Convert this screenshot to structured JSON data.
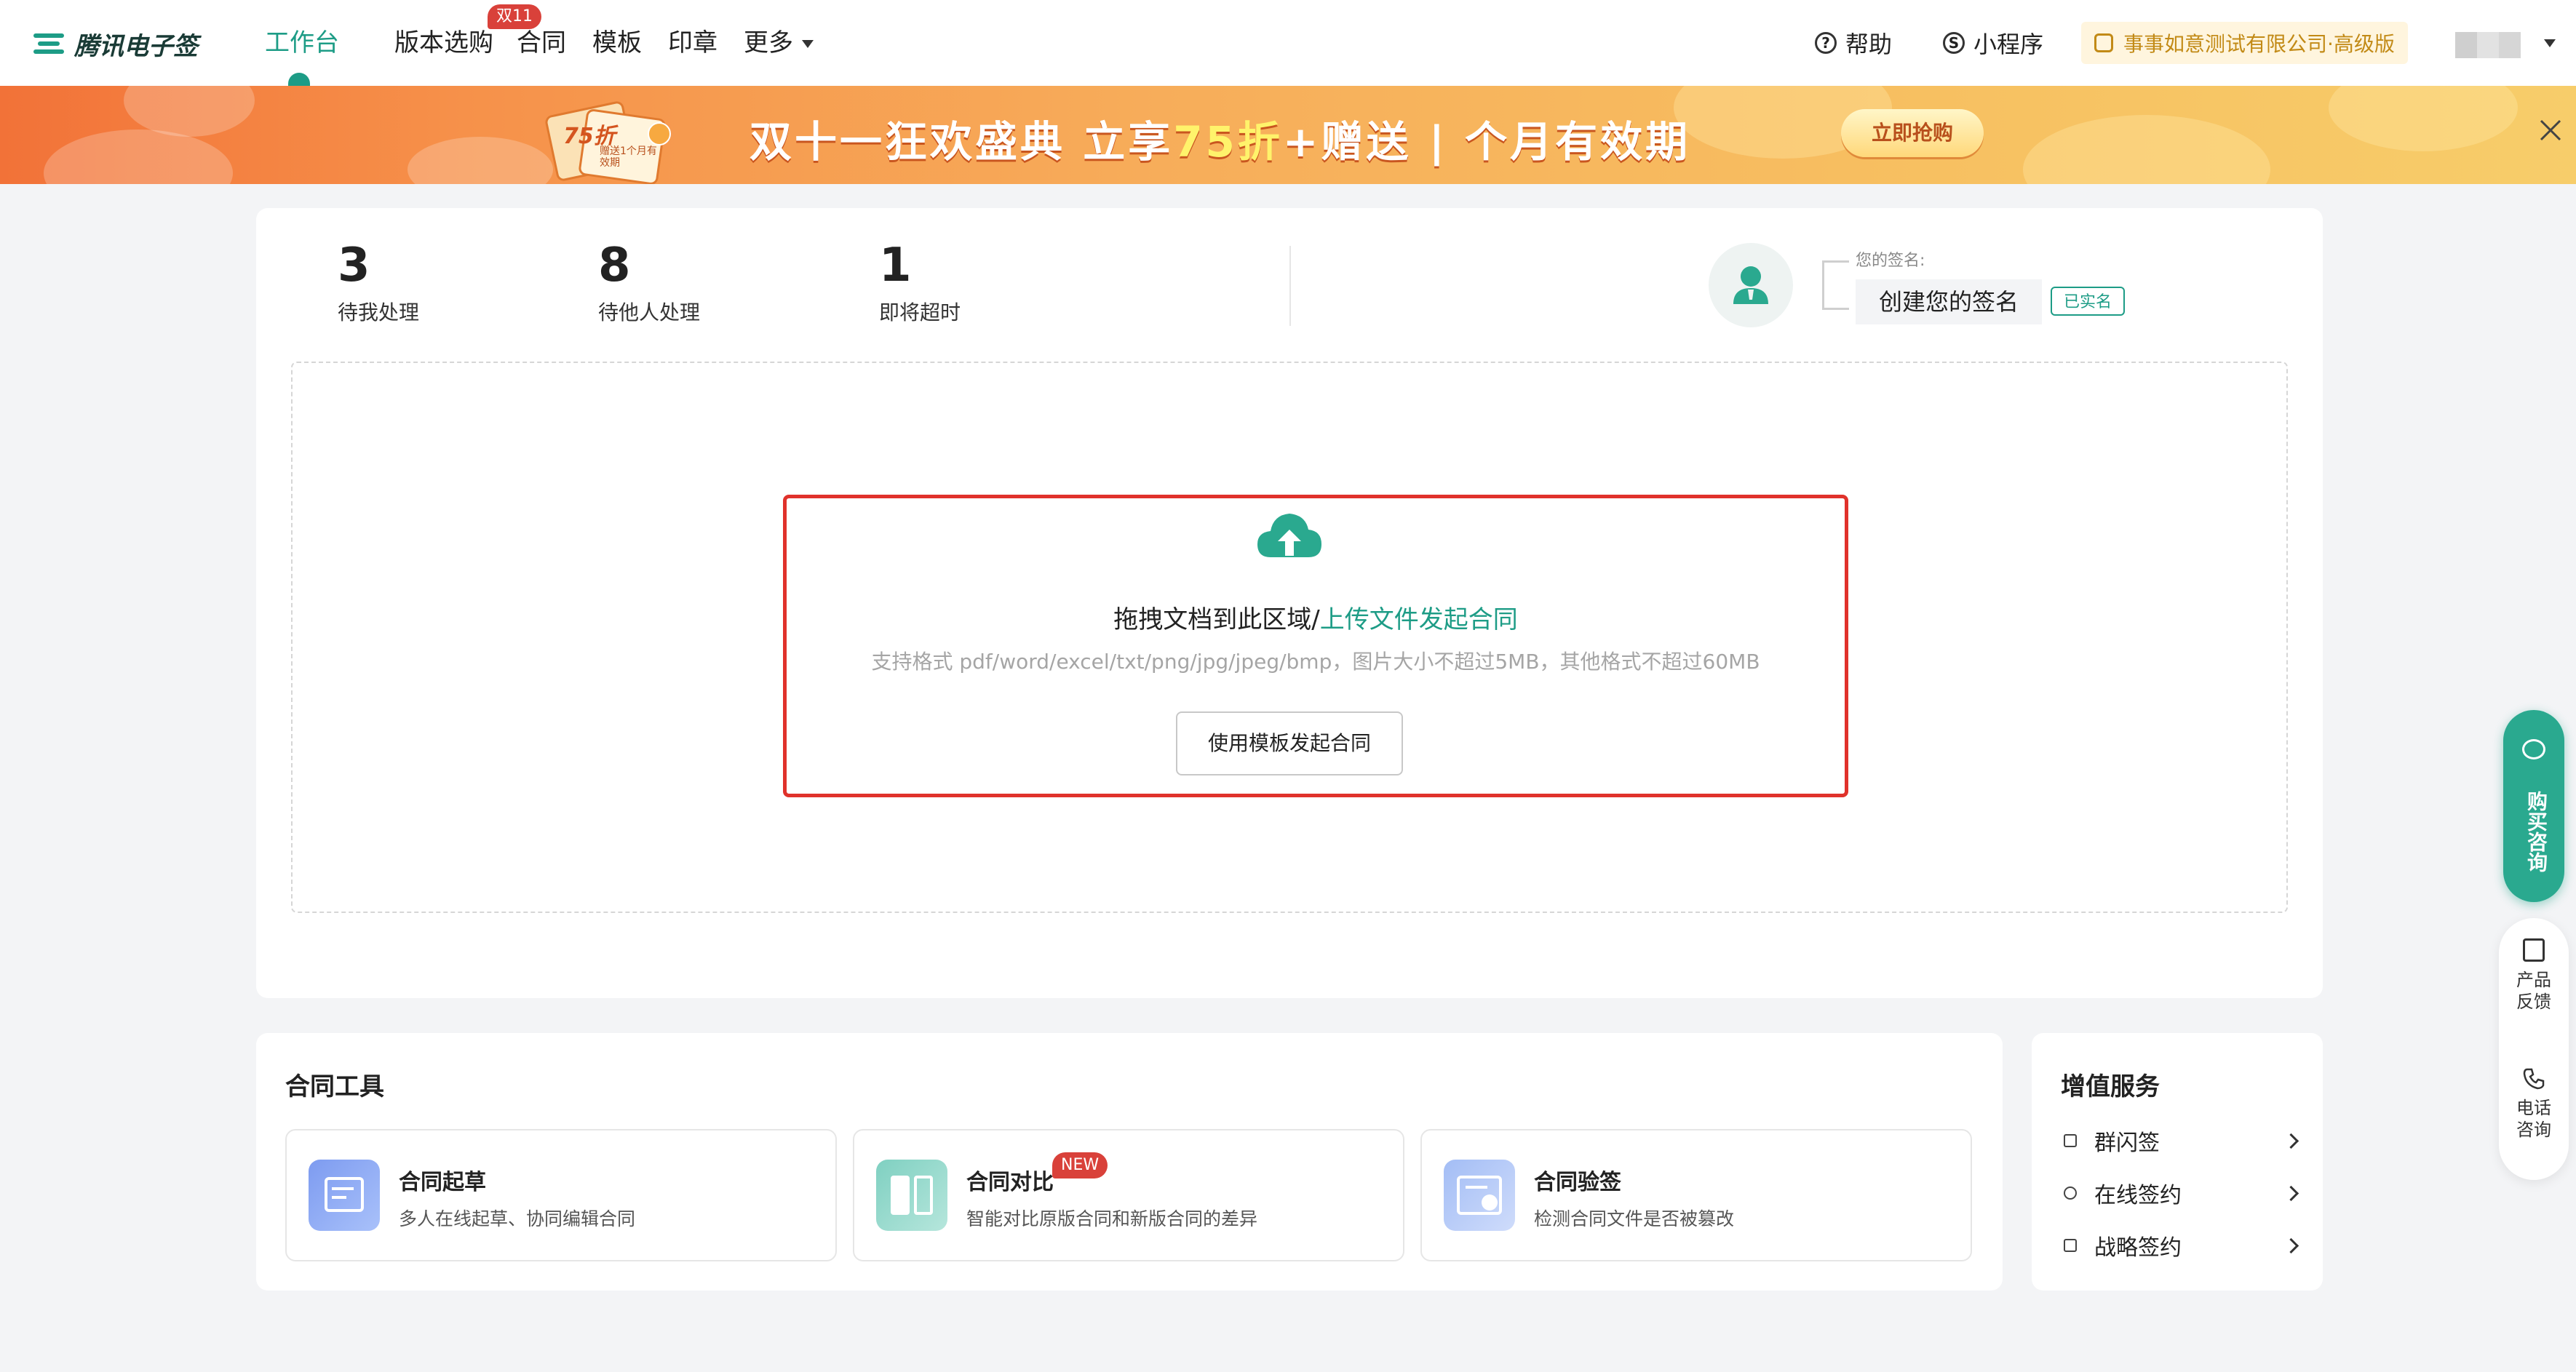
{
  "brand": {
    "logo_text": "腾讯电子签",
    "accent": "#1d9c86"
  },
  "nav": {
    "items": [
      {
        "label": "工作台",
        "active": true
      },
      {
        "label": "版本选购",
        "badge": "双11"
      },
      {
        "label": "合同"
      },
      {
        "label": "模板"
      },
      {
        "label": "印章"
      },
      {
        "label": "更多"
      }
    ],
    "help": "帮助",
    "miniprogram": "小程序",
    "company": "事事如意测试有限公司·高级版"
  },
  "banner": {
    "title_part1": "双十一狂欢盛典 立享",
    "title_highlight": "75折",
    "title_part2": "+赠送 | 个月有效期",
    "gift_label": "75折",
    "gift_sub": "赠送1个月有效期",
    "cta": "立即抢购"
  },
  "stats": [
    {
      "value": "3",
      "label": "待我处理"
    },
    {
      "value": "8",
      "label": "待他人处理"
    },
    {
      "value": "1",
      "label": "即将超时"
    }
  ],
  "signature": {
    "label": "您的签名:",
    "create": "创建您的签名",
    "verified": "已实名"
  },
  "upload": {
    "title_prefix": "拖拽文档到此区域/",
    "title_link": "上传文件发起合同",
    "hint": "支持格式 pdf/word/excel/txt/png/jpg/jpeg/bmp，图片大小不超过5MB，其他格式不超过60MB",
    "template_button": "使用模板发起合同"
  },
  "tools": {
    "title": "合同工具",
    "items": [
      {
        "name": "合同起草",
        "desc": "多人在线起草、协同编辑合同"
      },
      {
        "name": "合同对比",
        "desc": "智能对比原版合同和新版合同的差异",
        "badge": "NEW"
      },
      {
        "name": "合同验签",
        "desc": "检测合同文件是否被篡改"
      }
    ]
  },
  "services": {
    "title": "增值服务",
    "items": [
      {
        "label": "群闪签"
      },
      {
        "label": "在线签约"
      },
      {
        "label": "战略签约"
      }
    ]
  },
  "float": {
    "consult": "购买咨询",
    "feedback": "产品反馈",
    "phone": "电话咨询"
  }
}
